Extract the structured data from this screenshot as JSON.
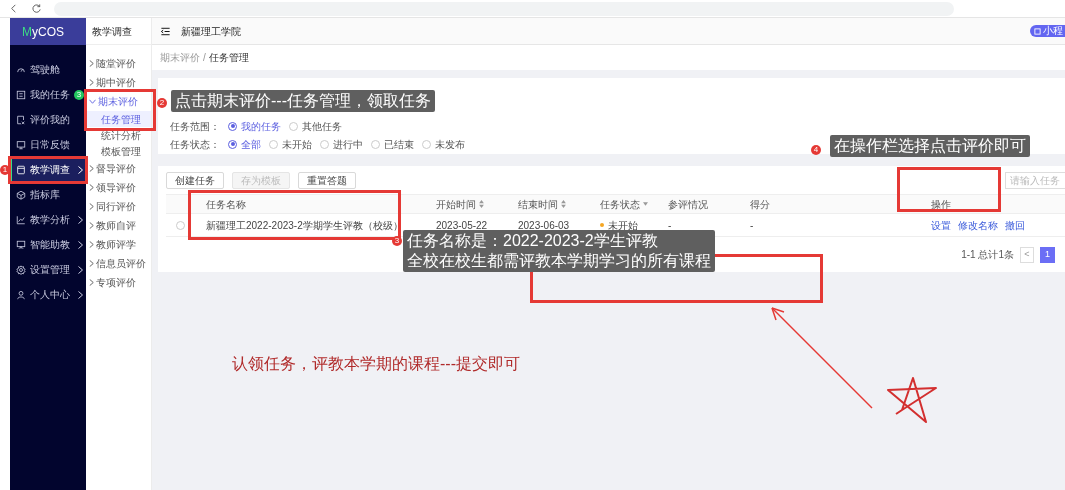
{
  "sidebar": {
    "logo": "MyCOS",
    "items": [
      {
        "label": "驾驶舱",
        "selected": false,
        "submenu": false
      },
      {
        "label": "我的任务",
        "selected": false,
        "submenu": false,
        "badge": "3"
      },
      {
        "label": "评价我的",
        "selected": false,
        "submenu": false
      },
      {
        "label": "日常反馈",
        "selected": false,
        "submenu": false
      },
      {
        "label": "教学调查",
        "selected": true,
        "submenu": true
      },
      {
        "label": "指标库",
        "selected": false,
        "submenu": false
      },
      {
        "label": "教学分析",
        "selected": false,
        "submenu": true
      },
      {
        "label": "智能助教",
        "selected": false,
        "submenu": true
      },
      {
        "label": "设置管理",
        "selected": false,
        "submenu": true
      },
      {
        "label": "个人中心",
        "selected": false,
        "submenu": true
      }
    ]
  },
  "subnav": {
    "title": "教学调查",
    "items": [
      {
        "label": "随堂评价",
        "expanded": false
      },
      {
        "label": "期中评价",
        "expanded": false
      },
      {
        "label": "期末评价",
        "expanded": true,
        "children": [
          {
            "label": "任务管理",
            "selected": true
          },
          {
            "label": "统计分析",
            "selected": false
          },
          {
            "label": "模板管理",
            "selected": false
          }
        ]
      },
      {
        "label": "督导评价",
        "expanded": false
      },
      {
        "label": "领导评价",
        "expanded": false
      },
      {
        "label": "同行评价",
        "expanded": false
      },
      {
        "label": "教师自评",
        "expanded": false
      },
      {
        "label": "教师评学",
        "expanded": false
      },
      {
        "label": "信息员评价",
        "expanded": false
      },
      {
        "label": "专项评价",
        "expanded": false
      }
    ]
  },
  "header": {
    "school": "新疆理工学院",
    "badge": "小程"
  },
  "breadcrumb": {
    "items": [
      "期末评价",
      "任务管理"
    ],
    "separator": "/"
  },
  "filters": [
    {
      "label": "任务范围：",
      "options": [
        {
          "label": "我的任务",
          "selected": true
        },
        {
          "label": "其他任务",
          "selected": false
        }
      ]
    },
    {
      "label": "任务状态：",
      "options": [
        {
          "label": "全部",
          "selected": true
        },
        {
          "label": "未开始",
          "selected": false
        },
        {
          "label": "进行中",
          "selected": false
        },
        {
          "label": "已结束",
          "selected": false
        },
        {
          "label": "未发布",
          "selected": false
        }
      ]
    }
  ],
  "toolbar": {
    "buttons": [
      {
        "label": "创建任务",
        "disabled": false
      },
      {
        "label": "存为模板",
        "disabled": true
      },
      {
        "label": "重置答题",
        "disabled": false
      }
    ],
    "search": {
      "placeholder": "请输入任务"
    }
  },
  "table": {
    "columns": [
      {
        "label": "任务名称",
        "kind": "plain"
      },
      {
        "label": "开始时间",
        "kind": "sort"
      },
      {
        "label": "结束时间",
        "kind": "sort"
      },
      {
        "label": "任务状态",
        "kind": "filter"
      },
      {
        "label": "参评情况",
        "kind": "plain"
      },
      {
        "label": "得分",
        "kind": "plain"
      },
      {
        "label": "操作",
        "kind": "plain"
      }
    ],
    "rows": [
      {
        "selected": false,
        "name": "新疆理工2022-2023-2学期学生评教（校级）",
        "start": "2023-05-22",
        "end": "2023-06-03",
        "status": {
          "label": "未开始",
          "color": "#f5a623"
        },
        "participation": "-",
        "score": "-",
        "actions": [
          "设置",
          "修改名称",
          "撤回"
        ]
      }
    ]
  },
  "pagination": {
    "summary": "1-1 总计1条",
    "prev": "<",
    "pages": [
      {
        "label": "1",
        "selected": true
      }
    ]
  },
  "annotations": {
    "steps": [
      {
        "number": "1"
      },
      {
        "number": "2",
        "callout": [
          "点击期末评价---任务管理，领取任务"
        ]
      },
      {
        "number": "3",
        "callout": [
          "任务名称是：2022-2023-2学生评教",
          "全校在校生都需评教本学期学习的所有课程"
        ]
      },
      {
        "number": "4",
        "callout": [
          "在操作栏选择点击评价即可"
        ]
      }
    ],
    "note": "认领任务，评教本学期的课程---提交即可"
  }
}
